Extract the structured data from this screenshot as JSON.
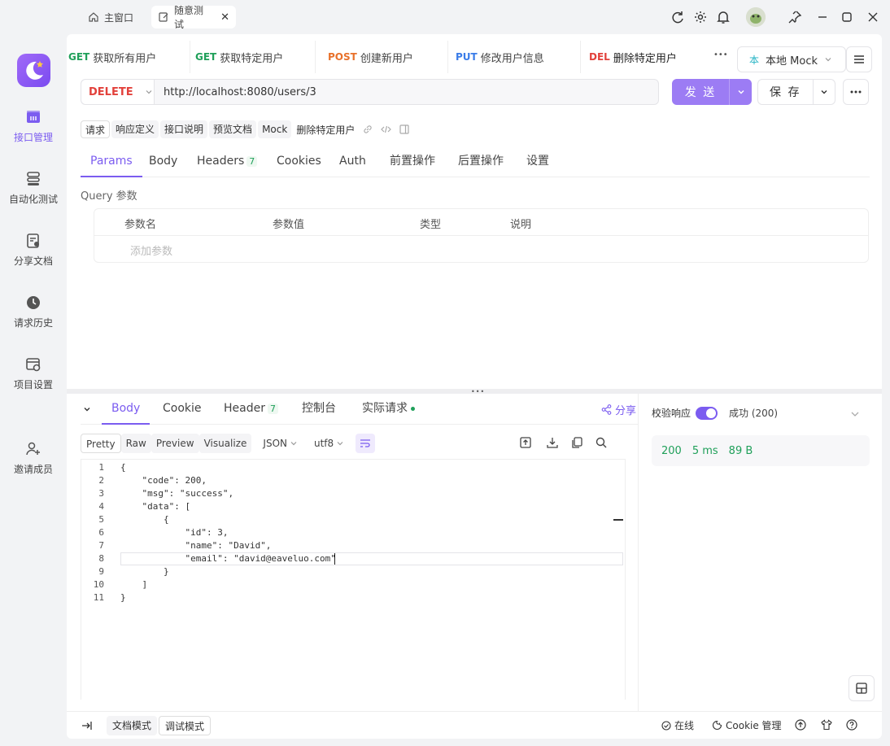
{
  "window": {
    "tabs": [
      {
        "label": "主窗口"
      },
      {
        "label": "随意测试",
        "close": "✕"
      }
    ]
  },
  "sidebar": {
    "items": [
      {
        "label": "接口管理",
        "active": true
      },
      {
        "label": "自动化测试"
      },
      {
        "label": "分享文档"
      },
      {
        "label": "请求历史"
      },
      {
        "label": "项目设置"
      },
      {
        "label": "邀请成员"
      }
    ]
  },
  "api_tabs": [
    {
      "method": "GET",
      "label": "获取所有用户"
    },
    {
      "method": "GET",
      "label": "获取特定用户"
    },
    {
      "method": "POST",
      "label": "创建新用户"
    },
    {
      "method": "PUT",
      "label": "修改用户信息"
    },
    {
      "method": "DEL",
      "label": "删除特定用户",
      "active": true
    }
  ],
  "more_dots": "•••",
  "environment": "本地 Mock",
  "env_icon_text": "本",
  "request": {
    "method": "DELETE",
    "url": "http://localhost:8080/users/3",
    "send_label": "发 送",
    "save_label": "保 存"
  },
  "sub_tabs": [
    "请求",
    "响应定义",
    "接口说明",
    "预览文档",
    "Mock"
  ],
  "api_name": "删除特定用户",
  "param_tabs": [
    {
      "label": "Params",
      "active": true
    },
    {
      "label": "Body"
    },
    {
      "label": "Headers",
      "badge": "7"
    },
    {
      "label": "Cookies"
    },
    {
      "label": "Auth"
    },
    {
      "label": "前置操作"
    },
    {
      "label": "后置操作"
    },
    {
      "label": "设置"
    }
  ],
  "query_label": "Query 参数",
  "param_table": {
    "headers": [
      "参数名",
      "参数值",
      "类型",
      "说明"
    ],
    "add_placeholder": "添加参数"
  },
  "response": {
    "tabs": [
      {
        "label": "Body",
        "active": true
      },
      {
        "label": "Cookie"
      },
      {
        "label": "Header",
        "badge": "7"
      },
      {
        "label": "控制台"
      },
      {
        "label": "实际请求",
        "dot": true
      }
    ],
    "share_label": "分享",
    "format_buttons": [
      "Pretty",
      "Raw",
      "Preview",
      "Visualize"
    ],
    "format": "JSON",
    "encoding": "utf8",
    "code_lines": [
      "{",
      "    \"code\": 200,",
      "    \"msg\": \"success\",",
      "    \"data\": [",
      "        {",
      "            \"id\": 3,",
      "            \"name\": \"David\",",
      "            \"email\": \"david@eaveluo.com\"",
      "        }",
      "    ]",
      "}"
    ],
    "line_numbers": [
      "1",
      "2",
      "3",
      "4",
      "5",
      "6",
      "7",
      "8",
      "9",
      "10",
      "11"
    ]
  },
  "validation": {
    "label": "校验响应",
    "result": "成功 (200)",
    "status": "200",
    "time": "5 ms",
    "size": "89 B"
  },
  "footer": {
    "doc_mode": "文档模式",
    "debug_mode": "调试模式",
    "online": "在线",
    "cookie": "Cookie 管理"
  },
  "colors": {
    "accent": "#7b5cf0",
    "get": "#20a05a",
    "post": "#e8712b",
    "put": "#3a7ce8",
    "delete": "#e2413b"
  }
}
